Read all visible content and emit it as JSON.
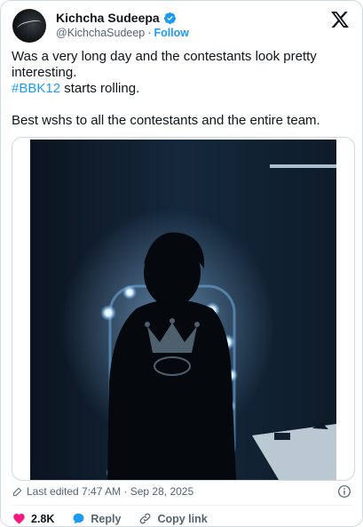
{
  "author": {
    "display_name": "Kichcha Sudeepa",
    "handle": "@KichchaSudeep",
    "separator": "·",
    "follow_label": "Follow"
  },
  "tweet": {
    "line1": "Was a very long day and the contestants look pretty interesting.",
    "hashtag": "#BBK12",
    "line2_rest": " starts rolling.",
    "line3": "Best wshs to all the contestants and the entire team."
  },
  "meta": {
    "edited": "Last edited 7:47 AM · Sep 28, 2025"
  },
  "actions": {
    "like_count": "2.8K",
    "reply_label": "Reply",
    "copy_label": "Copy link"
  },
  "colors": {
    "accent": "#1d9bf0",
    "like": "#f91880",
    "text": "#0f1419",
    "muted": "#536471"
  }
}
